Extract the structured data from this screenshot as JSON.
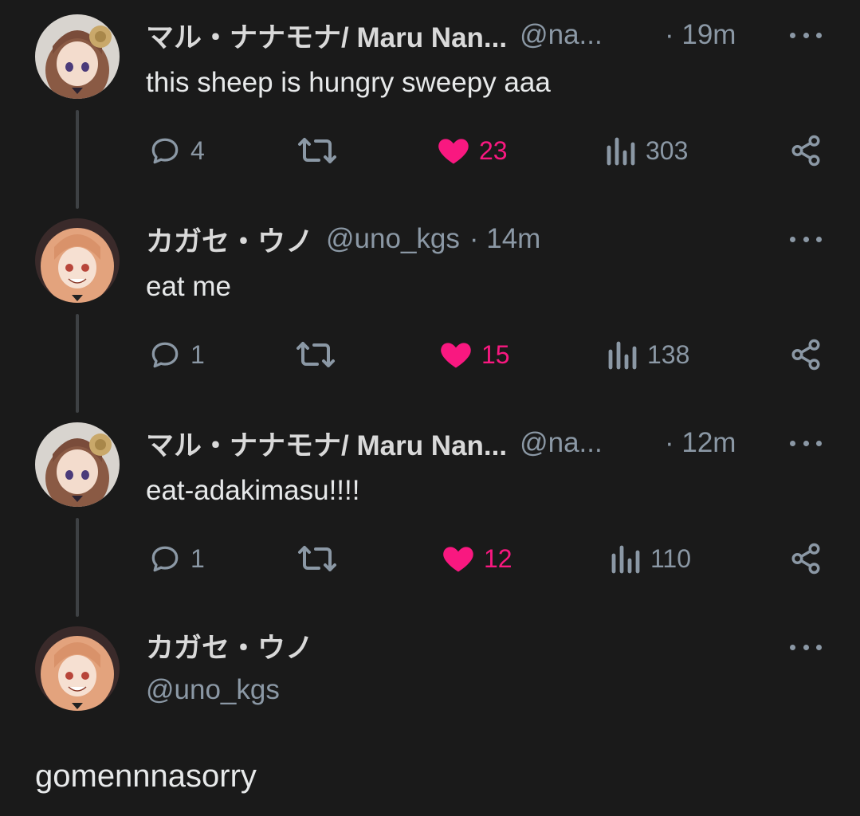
{
  "tweets": [
    {
      "name": "マル・ナナモナ/ Maru Nan...",
      "handle": "@na...",
      "time": "· 19m",
      "text": "this sheep is hungry sweepy aaa",
      "replies": "4",
      "likes": "23",
      "views": "303"
    },
    {
      "name": "カガセ・ウノ",
      "handle": "@uno_kgs",
      "time": "· 14m",
      "text": "eat me",
      "replies": "1",
      "likes": "15",
      "views": "138"
    },
    {
      "name": "マル・ナナモナ/ Maru Nan...",
      "handle": "@na...",
      "time": "· 12m",
      "text": "eat-adakimasu!!!!",
      "replies": "1",
      "likes": "12",
      "views": "110"
    }
  ],
  "main_tweet": {
    "name": "カガセ・ウノ",
    "handle": "@uno_kgs",
    "text": "gomennnasorry"
  },
  "colors": {
    "background": "#1a1a1a",
    "like": "#f91880",
    "muted": "#8b98a5"
  }
}
